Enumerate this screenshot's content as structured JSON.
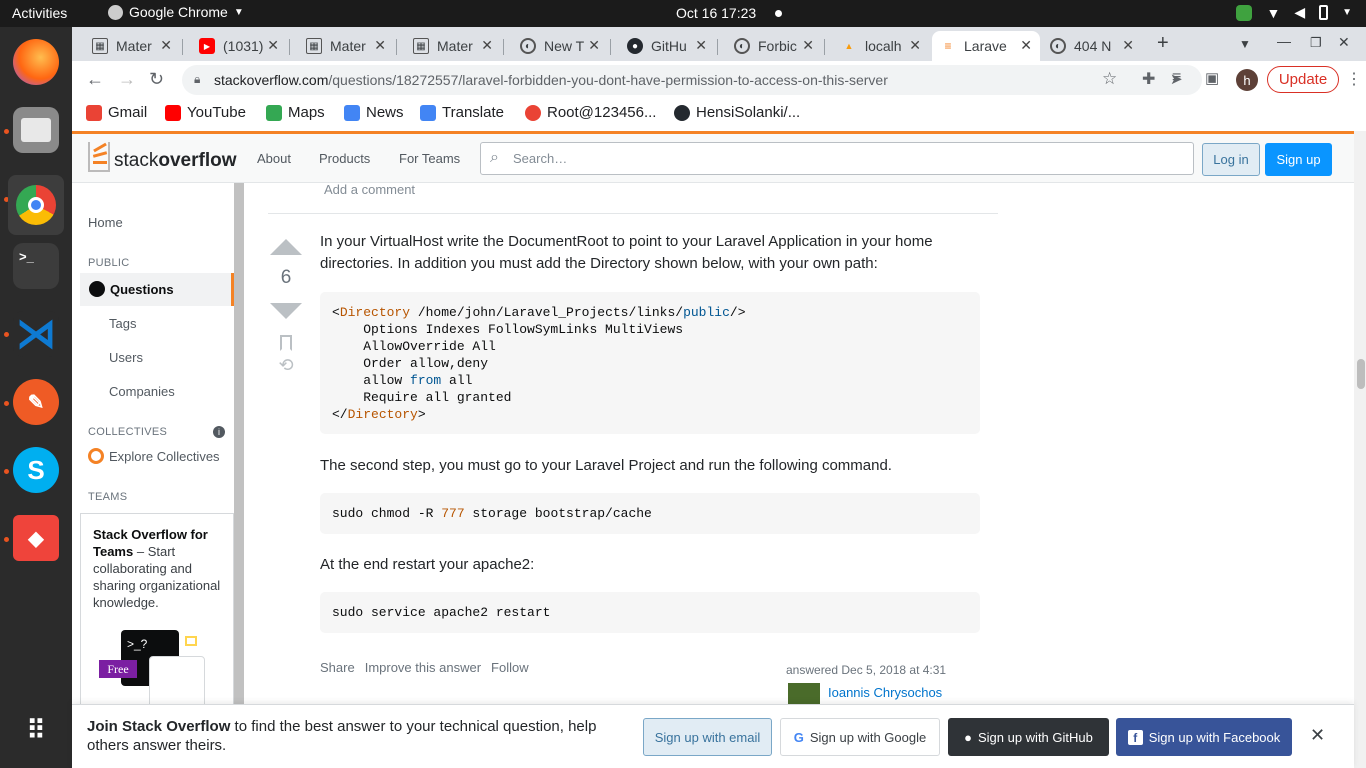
{
  "os": {
    "activities": "Activities",
    "app_name": "Google Chrome",
    "clock": "Oct 16  17:23"
  },
  "tabs": [
    {
      "label": "Mater",
      "icon": "apps-icon"
    },
    {
      "label": "(1031)",
      "icon": "youtube-icon"
    },
    {
      "label": "Mater",
      "icon": "apps-icon"
    },
    {
      "label": "Mater",
      "icon": "apps-icon"
    },
    {
      "label": "New T",
      "icon": "globe-icon"
    },
    {
      "label": "GitHu",
      "icon": "github-icon"
    },
    {
      "label": "Forbic",
      "icon": "globe-icon"
    },
    {
      "label": "localh",
      "icon": "pma-icon"
    },
    {
      "label": "Larave",
      "icon": "stackoverflow-icon"
    },
    {
      "label": "404 N",
      "icon": "globe-icon"
    }
  ],
  "address": {
    "host": "stackoverflow.com",
    "path": "/questions/18272557/laravel-forbidden-you-dont-have-permission-to-access-on-this-server"
  },
  "browser": {
    "update_label": "Update",
    "profile_initial": "h"
  },
  "bookmarks": [
    {
      "label": "Gmail",
      "color": "#ea4335"
    },
    {
      "label": "YouTube",
      "color": "#ff0000"
    },
    {
      "label": "Maps",
      "color": "#34a853"
    },
    {
      "label": "News",
      "color": "#4285f4"
    },
    {
      "label": "Translate",
      "color": "#4285f4"
    },
    {
      "label": "Root@123456...",
      "color": "#ea4335"
    },
    {
      "label": "HensiSolanki/...",
      "color": "#24292f"
    }
  ],
  "so": {
    "logo_light": "stack",
    "logo_bold": "overflow",
    "nav": [
      "About",
      "Products",
      "For Teams"
    ],
    "search_placeholder": "Search…",
    "login": "Log in",
    "signup": "Sign up"
  },
  "sidebar": {
    "home": "Home",
    "public": "PUBLIC",
    "questions": "Questions",
    "tags": "Tags",
    "users": "Users",
    "companies": "Companies",
    "collectives": "COLLECTIVES",
    "explore": "Explore Collectives",
    "teams": "TEAMS",
    "teams_title": "Stack Overflow for Teams",
    "teams_text": " – Start collaborating and sharing organizational knowledge.",
    "free_badge": "Free"
  },
  "answer": {
    "add_comment": "Add a comment",
    "score": "6",
    "p1": "In your VirtualHost write the DocumentRoot to point to your Laravel Application in your home directories. In addition you must add the Directory shown below, with your own path:",
    "p2": "The second step, you must go to your Laravel Project and run the following command.",
    "p3": "At the end restart your apache2:",
    "code2": "sudo chmod -R 777 storage bootstrap/cache",
    "code3": "sudo service apache2 restart",
    "share": "Share",
    "improve": "Improve this answer",
    "follow": "Follow",
    "answered": "answered Dec 5, 2018 at 4:31",
    "user": "Ioannis Chrysochos"
  },
  "banner": {
    "bold": "Join Stack Overflow",
    "rest": " to find the best answer to your technical question, help others answer theirs.",
    "email": "Sign up with email",
    "google": "Sign up with Google",
    "github": "Sign up with GitHub",
    "facebook": "Sign up with Facebook"
  }
}
